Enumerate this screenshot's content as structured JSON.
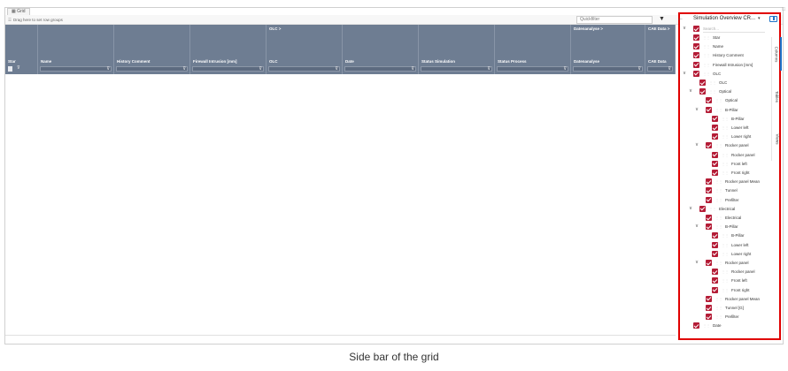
{
  "tab": {
    "label": "Grid",
    "icon": "grid-icon"
  },
  "toolbar": {
    "group_hint": "Drag here to set row groups",
    "quickfilter_placeholder": "Quickfilter"
  },
  "header": {
    "groups": {
      "olc": "OLC",
      "datenanalyse": "Datenanalyse",
      "cae": "CAE Data"
    },
    "columns": [
      {
        "label": "Star"
      },
      {
        "label": "Name"
      },
      {
        "label": "History Comment"
      },
      {
        "label": "Firewall Intrusion [mm]"
      },
      {
        "label": "OLC"
      },
      {
        "label": "Date"
      },
      {
        "label": "Status Simulation"
      },
      {
        "label": "Status Process"
      },
      {
        "label": "Datenanalyse"
      },
      {
        "label": "CAE Data"
      }
    ]
  },
  "sidebar": {
    "title": "Simulation Overview CR...",
    "search_placeholder": "Search...",
    "tabs": [
      "Columns",
      "Tables",
      "Views"
    ],
    "items": [
      {
        "label": "Star",
        "indent": 0,
        "expand": false
      },
      {
        "label": "Name",
        "indent": 0,
        "expand": false
      },
      {
        "label": "History Comment",
        "indent": 0,
        "expand": false
      },
      {
        "label": "Firewall Intrusion [mm]",
        "indent": 0,
        "expand": false
      },
      {
        "label": "OLC",
        "indent": 0,
        "expand": true
      },
      {
        "label": "OLC",
        "indent": 1,
        "expand": false
      },
      {
        "label": "Optical",
        "indent": 1,
        "expand": true
      },
      {
        "label": "Optical",
        "indent": 2,
        "expand": false
      },
      {
        "label": "B-Pillar",
        "indent": 2,
        "expand": true
      },
      {
        "label": "B-Pillar",
        "indent": 3,
        "expand": false
      },
      {
        "label": "Lower left",
        "indent": 3,
        "expand": false
      },
      {
        "label": "Lower right",
        "indent": 3,
        "expand": false
      },
      {
        "label": "Rocker panel",
        "indent": 2,
        "expand": true
      },
      {
        "label": "Rocker panel",
        "indent": 3,
        "expand": false
      },
      {
        "label": "Front left",
        "indent": 3,
        "expand": false
      },
      {
        "label": "Front right",
        "indent": 3,
        "expand": false
      },
      {
        "label": "Rocker panel Mean",
        "indent": 2,
        "expand": false
      },
      {
        "label": "Tunnel",
        "indent": 2,
        "expand": false
      },
      {
        "label": "Prefilter",
        "indent": 2,
        "expand": false
      },
      {
        "label": "Electrical",
        "indent": 1,
        "expand": true
      },
      {
        "label": "Electrical",
        "indent": 2,
        "expand": false
      },
      {
        "label": "B-Pillar",
        "indent": 2,
        "expand": true
      },
      {
        "label": "B-Pillar",
        "indent": 3,
        "expand": false
      },
      {
        "label": "Lower left",
        "indent": 3,
        "expand": false
      },
      {
        "label": "Lower right",
        "indent": 3,
        "expand": false
      },
      {
        "label": "Rocker panel",
        "indent": 2,
        "expand": true
      },
      {
        "label": "Rocker panel",
        "indent": 3,
        "expand": false
      },
      {
        "label": "Front left",
        "indent": 3,
        "expand": false
      },
      {
        "label": "Front right",
        "indent": 3,
        "expand": false
      },
      {
        "label": "Rocker panel Mean",
        "indent": 2,
        "expand": false
      },
      {
        "label": "Tunnel [G]",
        "indent": 2,
        "expand": false
      },
      {
        "label": "Prefilter",
        "indent": 2,
        "expand": false
      },
      {
        "label": "Date",
        "indent": 0,
        "expand": false
      }
    ]
  },
  "caption": "Side bar of the grid",
  "colors": {
    "header_bg": "#6e7d92",
    "checkbox": "#b41c36",
    "highlight_border": "#e00000",
    "accent": "#1e73c8"
  }
}
